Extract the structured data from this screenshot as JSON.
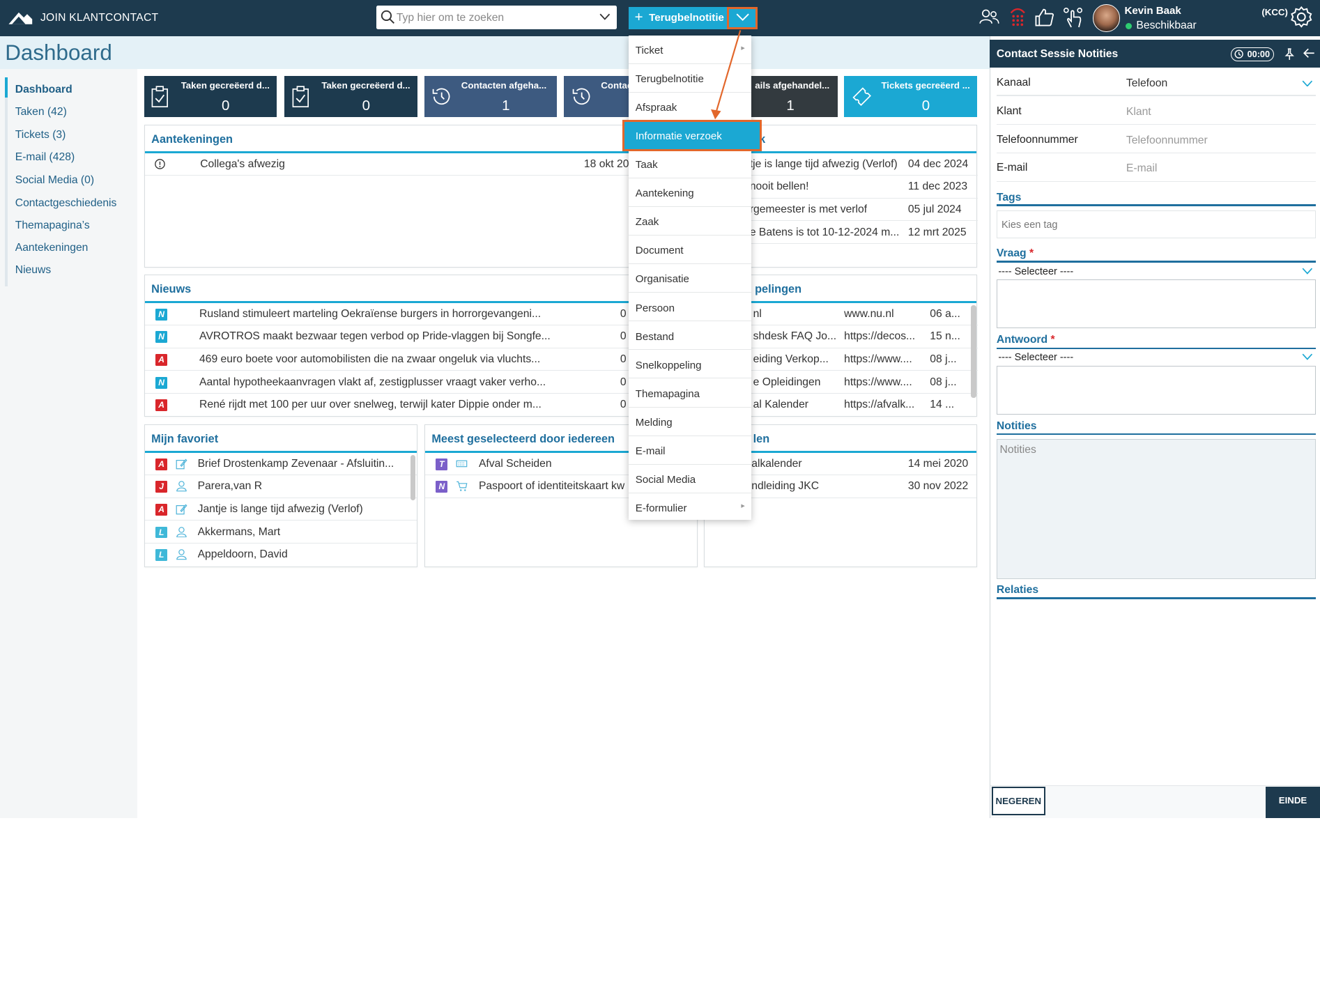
{
  "app": {
    "title": "JOIN KLANTCONTACT"
  },
  "search": {
    "placeholder": "Typ hier om te zoeken"
  },
  "action_button": {
    "label": "Terugbelnotitie"
  },
  "user": {
    "name": "Kevin Baak",
    "status": "Beschikbaar",
    "org": "(KCC)"
  },
  "page": {
    "title": "Dashboard"
  },
  "sidebar": {
    "items": [
      {
        "label": "Dashboard"
      },
      {
        "label": "Taken (42)"
      },
      {
        "label": "Tickets (3)"
      },
      {
        "label": "E-mail (428)"
      },
      {
        "label": "Social Media (0)"
      },
      {
        "label": "Contactgeschiedenis"
      },
      {
        "label": "Themapagina’s"
      },
      {
        "label": "Aantekeningen"
      },
      {
        "label": "Nieuws"
      }
    ]
  },
  "tiles": [
    {
      "label": "Taken gecreëerd d...",
      "value": "0",
      "color": "#1d3a4e",
      "icon": "clipboard-check-icon"
    },
    {
      "label": "Taken gecreëerd d...",
      "value": "0",
      "color": "#1d3a4e",
      "icon": "clipboard-check-icon"
    },
    {
      "label": "Contacten afgeha...",
      "value": "1",
      "color": "#3d5a80",
      "icon": "history-icon"
    },
    {
      "label": "Contac",
      "value": "",
      "color": "#3d5a80",
      "icon": "history-icon"
    },
    {
      "label": "ails afgehandel...",
      "value": "1",
      "color": "#333a3f",
      "icon": ""
    },
    {
      "label": "Tickets gecreëerd ...",
      "value": "0",
      "color": "#1ba8d3",
      "icon": "ticket-icon"
    }
  ],
  "aantekeningen": {
    "title": "Aantekeningen",
    "rows": [
      {
        "title": "Collega's afwezig",
        "date": "18 okt 20"
      }
    ]
  },
  "right_top_panel": {
    "title_fragment": "k",
    "rows": [
      {
        "title": "tje is lange tijd afwezig (Verlof)",
        "date": "04 dec 2024"
      },
      {
        "title": "nooit bellen!",
        "date": "11 dec 2023"
      },
      {
        "title": "rgemeester is met verlof",
        "date": "05 jul 2024"
      },
      {
        "title": "e Batens is tot 10-12-2024 m...",
        "date": "12 mrt 2025"
      }
    ]
  },
  "nieuws": {
    "title": "Nieuws",
    "rows": [
      {
        "badge": "N",
        "title": "Rusland stimuleert marteling Oekraïense burgers in horrorgevangeni...",
        "date": "0"
      },
      {
        "badge": "N",
        "title": "AVROTROS maakt bezwaar tegen verbod op Pride-vlaggen bij Songfe...",
        "date": "0"
      },
      {
        "badge": "A",
        "title": "469 euro boete voor automobilisten die na zwaar ongeluk via vluchts...",
        "date": "0"
      },
      {
        "badge": "N",
        "title": "Aantal hypotheekaanvragen vlakt af, zestigplusser vraagt vaker verho...",
        "date": "0"
      },
      {
        "badge": "A",
        "title": "René rijdt met 100 per uur over snelweg, terwijl kater Dippie onder m...",
        "date": "0"
      }
    ]
  },
  "koppelingen": {
    "title_fragment": "pelingen",
    "rows": [
      {
        "title": "nl",
        "url": "www.nu.nl",
        "date": "06 a..."
      },
      {
        "title": "shdesk FAQ Jo...",
        "url": "https://decos...",
        "date": "15 n..."
      },
      {
        "title": "eiding Verkop...",
        "url": "https://www....",
        "date": "08 j..."
      },
      {
        "title": "e Opleidingen",
        "url": "https://www....",
        "date": "08 j..."
      },
      {
        "title": "al Kalender",
        "url": "https://afvalk...",
        "date": "14 ..."
      }
    ]
  },
  "favoriet": {
    "title": "Mijn favoriet",
    "rows": [
      {
        "badge": "A",
        "icon": "edit-icon",
        "title": "Brief Drostenkamp Zevenaar - Afsluitin..."
      },
      {
        "badge": "J",
        "icon": "person-icon",
        "title": "Parera,van R"
      },
      {
        "badge": "A",
        "icon": "edit-icon",
        "title": "Jantje is lange tijd afwezig (Verlof)"
      },
      {
        "badge": "L",
        "icon": "person-icon",
        "title": "Akkermans, Mart"
      },
      {
        "badge": "L",
        "icon": "person-icon",
        "title": "Appeldoorn, David"
      }
    ]
  },
  "meest": {
    "title": "Meest geselecteerd door iedereen",
    "rows": [
      {
        "badge": "T",
        "icon": "keyboard-icon",
        "title": "Afval Scheiden"
      },
      {
        "badge": "N",
        "icon": "cart-icon",
        "title": "Paspoort of identiteitskaart kw"
      }
    ]
  },
  "bottom_right_panel": {
    "title_fragment": "len",
    "rows": [
      {
        "title": "alkalender",
        "date": "14 mei 2020"
      },
      {
        "title": "ndleiding JKC",
        "date": "30 nov 2022"
      }
    ]
  },
  "badge_colors": {
    "N": "#1ba8d3",
    "A": "#d9262b",
    "J": "#d9262b",
    "L": "#3fb8d8",
    "T": "#7b5fc9"
  },
  "dropdown_menu": {
    "items": [
      {
        "label": "Ticket",
        "submenu": true
      },
      {
        "label": "Terugbelnotitie"
      },
      {
        "label": "Afspraak"
      },
      {
        "label": "Informatie verzoek",
        "selected": true
      },
      {
        "label": "Taak"
      },
      {
        "label": "Aantekening"
      },
      {
        "label": "Zaak"
      },
      {
        "label": "Document"
      },
      {
        "label": "Organisatie"
      },
      {
        "label": "Persoon"
      },
      {
        "label": "Bestand"
      },
      {
        "label": "Snelkoppeling"
      },
      {
        "label": "Themapagina"
      },
      {
        "label": "Melding"
      },
      {
        "label": "E-mail"
      },
      {
        "label": "Social Media"
      },
      {
        "label": "E-formulier",
        "submenu": true
      }
    ]
  },
  "session": {
    "title": "Contact Sessie Notities",
    "timer": "00:00",
    "fields": {
      "kanaal_label": "Kanaal",
      "kanaal_value": "Telefoon",
      "klant_label": "Klant",
      "klant_placeholder": "Klant",
      "telefoon_label": "Telefoonnummer",
      "telefoon_placeholder": "Telefoonnummer",
      "email_label": "E-mail",
      "email_placeholder": "E-mail"
    },
    "tags_label": "Tags",
    "tags_placeholder": "Kies een tag",
    "vraag_label": "Vraag",
    "vraag_select": "---- Selecteer ----",
    "antwoord_label": "Antwoord",
    "antwoord_select": "---- Selecteer ----",
    "notities_label": "Notities",
    "notities_placeholder": "Notities",
    "relaties_label": "Relaties",
    "negeren_label": "NEGEREN",
    "einde_label": "EINDE",
    "required_mark": "*"
  },
  "accent_color": "#1ba8d3",
  "highlight_color": "#e2672b"
}
